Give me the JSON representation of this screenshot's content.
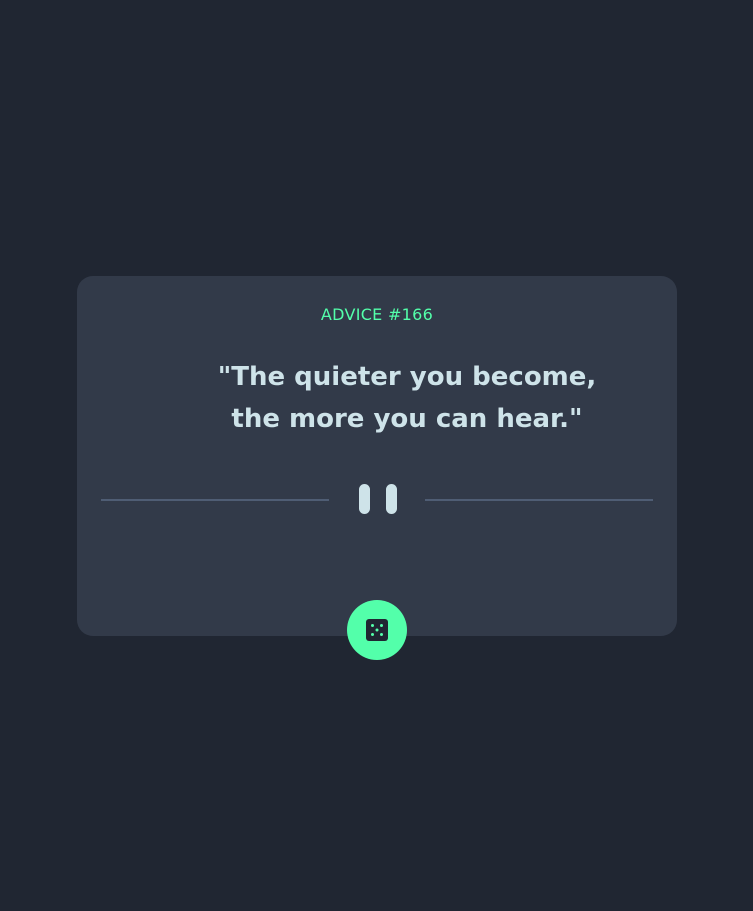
{
  "card": {
    "advice_label": "ADVICE #166",
    "quote": "\"The quieter you become, the more you can hear.\""
  },
  "colors": {
    "background": "#202632",
    "card": "#323a49",
    "accent": "#53ffaa",
    "text": "#cee3e9",
    "divider": "#4f5d74"
  },
  "icons": {
    "divider": "pause-icon",
    "button": "dice-icon"
  }
}
